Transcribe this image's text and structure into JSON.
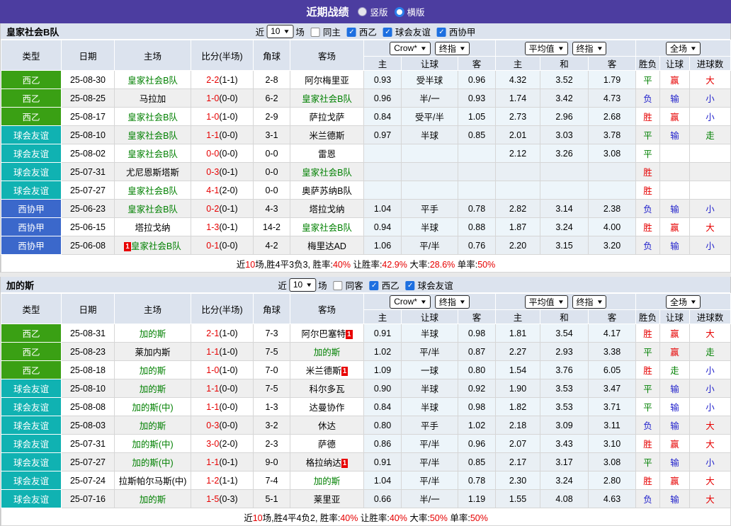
{
  "titlebar": {
    "title": "近期战绩",
    "radio_vertical_label": "竖版",
    "radio_horizontal_label": "横版",
    "bar_color": "#4c3da0"
  },
  "header": {
    "static_columns": [
      "类型",
      "日期",
      "主场",
      "比分(半场)",
      "角球",
      "客场"
    ],
    "groups": [
      {
        "dropdowns": [
          "Crow*",
          "终指"
        ],
        "subs": [
          "主",
          "让球",
          "客"
        ]
      },
      {
        "dropdowns": [
          "平均值",
          "终指"
        ],
        "subs": [
          "主",
          "和",
          "客"
        ]
      },
      {
        "dropdowns": [
          "全场"
        ],
        "subs": [
          "胜负",
          "让球",
          "进球数"
        ]
      }
    ]
  },
  "league_colors": {
    "西乙": "#3aa014",
    "球会友谊": "#10b2b2",
    "西协甲": "#3b68cb"
  },
  "result_colors": {
    "胜": "#e60000",
    "平": "#008000",
    "负": "#2222cc",
    "赢": "#e60000",
    "输": "#2222cc",
    "走": "#008000",
    "大": "#e60000",
    "小": "#2222cc"
  },
  "tables": [
    {
      "team": "皇家社会B队",
      "filter": {
        "near_label": "近",
        "count": "10",
        "matches_label": "场",
        "options": [
          {
            "label": "同主",
            "checked": false
          },
          {
            "label": "西乙",
            "checked": true
          },
          {
            "label": "球会友谊",
            "checked": true
          },
          {
            "label": "西协甲",
            "checked": true
          }
        ]
      },
      "rows": [
        {
          "league": "西乙",
          "date": "25-08-30",
          "home": "皇家社会B队",
          "home_green": true,
          "home_badge": false,
          "score": "2-2",
          "half": "(1-1)",
          "corners": "2-8",
          "away": "阿尔梅里亚",
          "away_green": false,
          "away_badge": false,
          "crow_odds": [
            "0.93",
            "受半球",
            "0.96"
          ],
          "avg_odds": [
            "4.32",
            "3.52",
            "1.79"
          ],
          "results": [
            "平",
            "赢",
            "大"
          ]
        },
        {
          "league": "西乙",
          "date": "25-08-25",
          "home": "马拉加",
          "home_green": false,
          "home_badge": false,
          "score": "1-0",
          "half": "(0-0)",
          "corners": "6-2",
          "away": "皇家社会B队",
          "away_green": true,
          "away_badge": false,
          "crow_odds": [
            "0.96",
            "半/一",
            "0.93"
          ],
          "avg_odds": [
            "1.74",
            "3.42",
            "4.73"
          ],
          "results": [
            "负",
            "输",
            "小"
          ]
        },
        {
          "league": "西乙",
          "date": "25-08-17",
          "home": "皇家社会B队",
          "home_green": true,
          "home_badge": false,
          "score": "1-0",
          "half": "(1-0)",
          "corners": "2-9",
          "away": "萨拉戈萨",
          "away_green": false,
          "away_badge": false,
          "crow_odds": [
            "0.84",
            "受平/半",
            "1.05"
          ],
          "avg_odds": [
            "2.73",
            "2.96",
            "2.68"
          ],
          "results": [
            "胜",
            "赢",
            "小"
          ]
        },
        {
          "league": "球会友谊",
          "date": "25-08-10",
          "home": "皇家社会B队",
          "home_green": true,
          "home_badge": false,
          "score": "1-1",
          "half": "(0-0)",
          "corners": "3-1",
          "away": "米兰德斯",
          "away_green": false,
          "away_badge": false,
          "crow_odds": [
            "0.97",
            "半球",
            "0.85"
          ],
          "avg_odds": [
            "2.01",
            "3.03",
            "3.78"
          ],
          "results": [
            "平",
            "输",
            "走"
          ]
        },
        {
          "league": "球会友谊",
          "date": "25-08-02",
          "home": "皇家社会B队",
          "home_green": true,
          "home_badge": false,
          "score": "0-0",
          "half": "(0-0)",
          "corners": "0-0",
          "away": "雷恩",
          "away_green": false,
          "away_badge": false,
          "crow_odds": [
            "",
            "",
            ""
          ],
          "avg_odds": [
            "2.12",
            "3.26",
            "3.08"
          ],
          "results": [
            "平",
            "",
            ""
          ]
        },
        {
          "league": "球会友谊",
          "date": "25-07-31",
          "home": "尤尼恩斯塔斯",
          "home_green": false,
          "home_badge": false,
          "score": "0-3",
          "half": "(0-1)",
          "corners": "0-0",
          "away": "皇家社会B队",
          "away_green": true,
          "away_badge": false,
          "crow_odds": [
            "",
            "",
            ""
          ],
          "avg_odds": [
            "",
            "",
            ""
          ],
          "results": [
            "胜",
            "",
            ""
          ]
        },
        {
          "league": "球会友谊",
          "date": "25-07-27",
          "home": "皇家社会B队",
          "home_green": true,
          "home_badge": false,
          "score": "4-1",
          "half": "(2-0)",
          "corners": "0-0",
          "away": "奥萨苏纳B队",
          "away_green": false,
          "away_badge": false,
          "crow_odds": [
            "",
            "",
            ""
          ],
          "avg_odds": [
            "",
            "",
            ""
          ],
          "results": [
            "胜",
            "",
            ""
          ]
        },
        {
          "league": "西协甲",
          "date": "25-06-23",
          "home": "皇家社会B队",
          "home_green": true,
          "home_badge": false,
          "score": "0-2",
          "half": "(0-1)",
          "corners": "4-3",
          "away": "塔拉戈纳",
          "away_green": false,
          "away_badge": false,
          "crow_odds": [
            "1.04",
            "平手",
            "0.78"
          ],
          "avg_odds": [
            "2.82",
            "3.14",
            "2.38"
          ],
          "results": [
            "负",
            "输",
            "小"
          ]
        },
        {
          "league": "西协甲",
          "date": "25-06-15",
          "home": "塔拉戈纳",
          "home_green": false,
          "home_badge": false,
          "score": "1-3",
          "half": "(0-1)",
          "corners": "14-2",
          "away": "皇家社会B队",
          "away_green": true,
          "away_badge": false,
          "crow_odds": [
            "0.94",
            "半球",
            "0.88"
          ],
          "avg_odds": [
            "1.87",
            "3.24",
            "4.00"
          ],
          "results": [
            "胜",
            "赢",
            "大"
          ]
        },
        {
          "league": "西协甲",
          "date": "25-06-08",
          "home": "皇家社会B队",
          "home_green": true,
          "home_badge": true,
          "score": "0-1",
          "half": "(0-0)",
          "corners": "4-2",
          "away": "梅里达AD",
          "away_green": false,
          "away_badge": false,
          "crow_odds": [
            "1.06",
            "平/半",
            "0.76"
          ],
          "avg_odds": [
            "2.20",
            "3.15",
            "3.20"
          ],
          "results": [
            "负",
            "输",
            "小"
          ]
        }
      ],
      "summary": [
        {
          "text": "近",
          "red": false
        },
        {
          "text": "10",
          "red": true
        },
        {
          "text": "场,胜4平3负3, 胜率:",
          "red": false
        },
        {
          "text": "40%",
          "red": true
        },
        {
          "text": " 让胜率:",
          "red": false
        },
        {
          "text": "42.9%",
          "red": true
        },
        {
          "text": " 大率:",
          "red": false
        },
        {
          "text": "28.6%",
          "red": true
        },
        {
          "text": " 单率:",
          "red": false
        },
        {
          "text": "50%",
          "red": true
        }
      ]
    },
    {
      "team": "加的斯",
      "filter": {
        "near_label": "近",
        "count": "10",
        "matches_label": "场",
        "options": [
          {
            "label": "同客",
            "checked": false
          },
          {
            "label": "西乙",
            "checked": true
          },
          {
            "label": "球会友谊",
            "checked": true
          }
        ]
      },
      "rows": [
        {
          "league": "西乙",
          "date": "25-08-31",
          "home": "加的斯",
          "home_green": true,
          "home_badge": false,
          "score": "2-1",
          "half": "(1-0)",
          "corners": "7-3",
          "away": "阿尔巴塞特",
          "away_green": false,
          "away_badge": true,
          "crow_odds": [
            "0.91",
            "半球",
            "0.98"
          ],
          "avg_odds": [
            "1.81",
            "3.54",
            "4.17"
          ],
          "results": [
            "胜",
            "赢",
            "大"
          ]
        },
        {
          "league": "西乙",
          "date": "25-08-23",
          "home": "莱加内斯",
          "home_green": false,
          "home_badge": false,
          "score": "1-1",
          "half": "(1-0)",
          "corners": "7-5",
          "away": "加的斯",
          "away_green": true,
          "away_badge": false,
          "crow_odds": [
            "1.02",
            "平/半",
            "0.87"
          ],
          "avg_odds": [
            "2.27",
            "2.93",
            "3.38"
          ],
          "results": [
            "平",
            "赢",
            "走"
          ]
        },
        {
          "league": "西乙",
          "date": "25-08-18",
          "home": "加的斯",
          "home_green": true,
          "home_badge": false,
          "score": "1-0",
          "half": "(1-0)",
          "corners": "7-0",
          "away": "米兰德斯",
          "away_green": false,
          "away_badge": true,
          "crow_odds": [
            "1.09",
            "一球",
            "0.80"
          ],
          "avg_odds": [
            "1.54",
            "3.76",
            "6.05"
          ],
          "results": [
            "胜",
            "走",
            "小"
          ]
        },
        {
          "league": "球会友谊",
          "date": "25-08-10",
          "home": "加的斯",
          "home_green": true,
          "home_badge": false,
          "score": "1-1",
          "half": "(0-0)",
          "corners": "7-5",
          "away": "科尔多瓦",
          "away_green": false,
          "away_badge": false,
          "crow_odds": [
            "0.90",
            "半球",
            "0.92"
          ],
          "avg_odds": [
            "1.90",
            "3.53",
            "3.47"
          ],
          "results": [
            "平",
            "输",
            "小"
          ]
        },
        {
          "league": "球会友谊",
          "date": "25-08-08",
          "home": "加的斯(中)",
          "home_green": true,
          "home_badge": false,
          "score": "1-1",
          "half": "(0-0)",
          "corners": "1-3",
          "away": "达曼协作",
          "away_green": false,
          "away_badge": false,
          "crow_odds": [
            "0.84",
            "半球",
            "0.98"
          ],
          "avg_odds": [
            "1.82",
            "3.53",
            "3.71"
          ],
          "results": [
            "平",
            "输",
            "小"
          ]
        },
        {
          "league": "球会友谊",
          "date": "25-08-03",
          "home": "加的斯",
          "home_green": true,
          "home_badge": false,
          "score": "0-3",
          "half": "(0-0)",
          "corners": "3-2",
          "away": "休达",
          "away_green": false,
          "away_badge": false,
          "crow_odds": [
            "0.80",
            "平手",
            "1.02"
          ],
          "avg_odds": [
            "2.18",
            "3.09",
            "3.11"
          ],
          "results": [
            "负",
            "输",
            "大"
          ]
        },
        {
          "league": "球会友谊",
          "date": "25-07-31",
          "home": "加的斯(中)",
          "home_green": true,
          "home_badge": false,
          "score": "3-0",
          "half": "(2-0)",
          "corners": "2-3",
          "away": "萨德",
          "away_green": false,
          "away_badge": false,
          "crow_odds": [
            "0.86",
            "平/半",
            "0.96"
          ],
          "avg_odds": [
            "2.07",
            "3.43",
            "3.10"
          ],
          "results": [
            "胜",
            "赢",
            "大"
          ]
        },
        {
          "league": "球会友谊",
          "date": "25-07-27",
          "home": "加的斯(中)",
          "home_green": true,
          "home_badge": false,
          "score": "1-1",
          "half": "(0-1)",
          "corners": "9-0",
          "away": "格拉纳达",
          "away_green": false,
          "away_badge": true,
          "crow_odds": [
            "0.91",
            "平/半",
            "0.85"
          ],
          "avg_odds": [
            "2.17",
            "3.17",
            "3.08"
          ],
          "results": [
            "平",
            "输",
            "小"
          ]
        },
        {
          "league": "球会友谊",
          "date": "25-07-24",
          "home": "拉斯帕尔马斯(中)",
          "home_green": false,
          "home_badge": false,
          "score": "1-2",
          "half": "(1-1)",
          "corners": "7-4",
          "away": "加的斯",
          "away_green": true,
          "away_badge": false,
          "crow_odds": [
            "1.04",
            "平/半",
            "0.78"
          ],
          "avg_odds": [
            "2.30",
            "3.24",
            "2.80"
          ],
          "results": [
            "胜",
            "赢",
            "大"
          ]
        },
        {
          "league": "球会友谊",
          "date": "25-07-16",
          "home": "加的斯",
          "home_green": true,
          "home_badge": false,
          "score": "1-5",
          "half": "(0-3)",
          "corners": "5-1",
          "away": "莱里亚",
          "away_green": false,
          "away_badge": false,
          "crow_odds": [
            "0.66",
            "半/一",
            "1.19"
          ],
          "avg_odds": [
            "1.55",
            "4.08",
            "4.63"
          ],
          "results": [
            "负",
            "输",
            "大"
          ]
        }
      ],
      "summary": [
        {
          "text": "近",
          "red": false
        },
        {
          "text": "10",
          "red": true
        },
        {
          "text": "场,胜4平4负2, 胜率:",
          "red": false
        },
        {
          "text": "40%",
          "red": true
        },
        {
          "text": " 让胜率:",
          "red": false
        },
        {
          "text": "40%",
          "red": true
        },
        {
          "text": " 大率:",
          "red": false
        },
        {
          "text": "50%",
          "red": true
        },
        {
          "text": " 单率:",
          "red": false
        },
        {
          "text": "50%",
          "red": true
        }
      ]
    }
  ],
  "badge_text": "1"
}
